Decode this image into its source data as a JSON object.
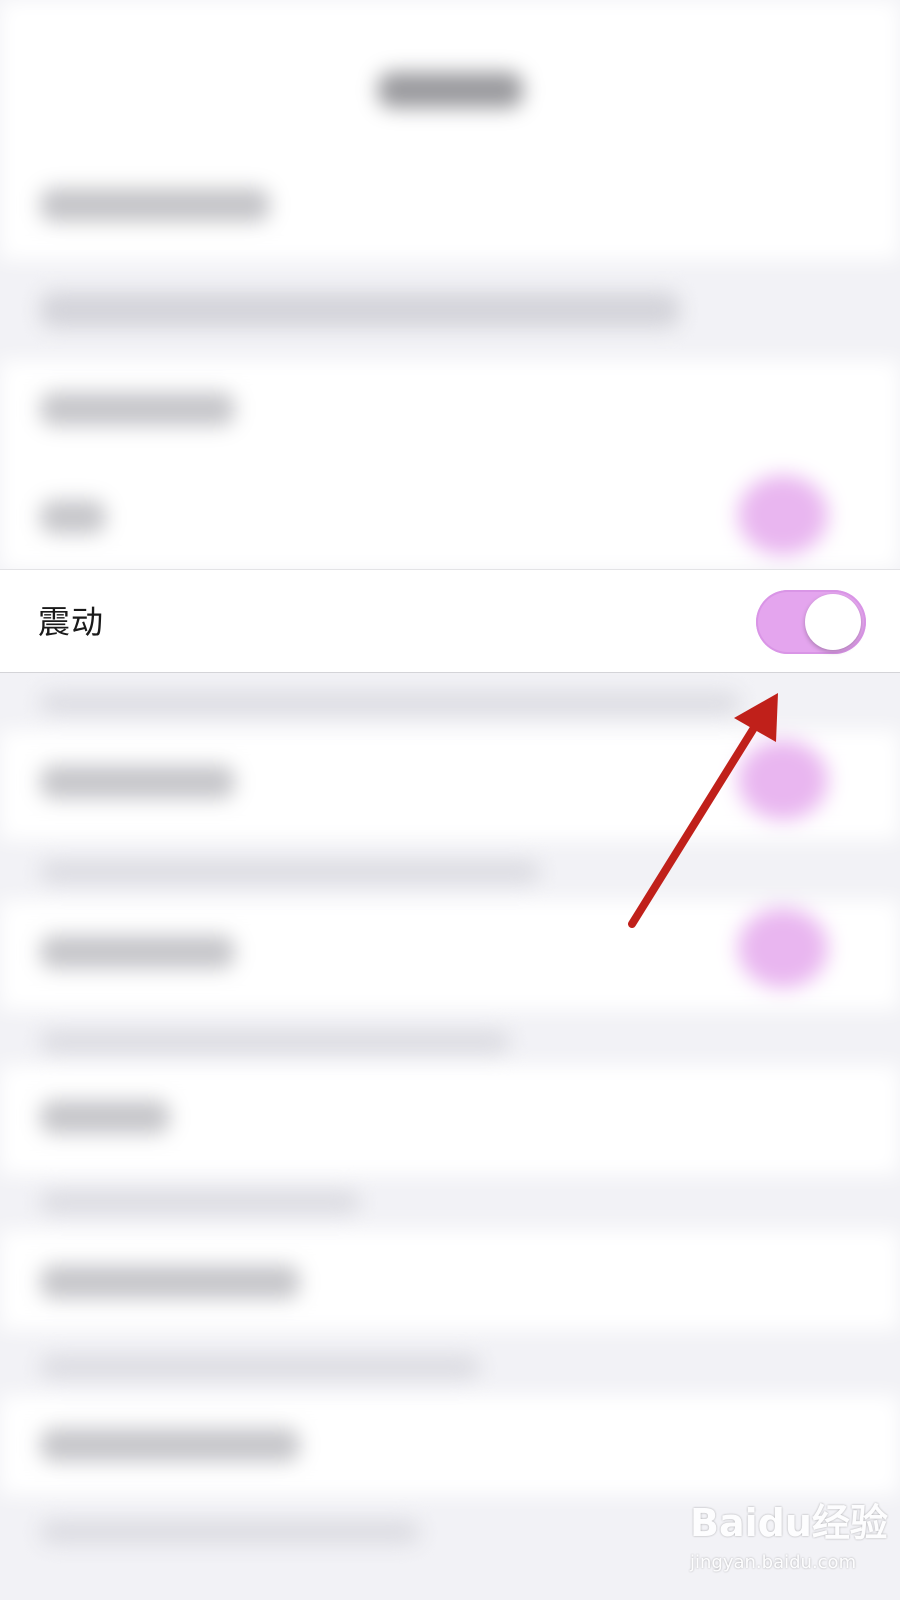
{
  "settings_row": {
    "label": "震动",
    "toggle_state": "on"
  },
  "colors": {
    "toggle_on": "#e4a5ee",
    "annotation_arrow": "#c0201a",
    "page_background": "#f2f2f6"
  },
  "watermark": {
    "brand": "Baidu经验",
    "url": "jingyan.baidu.com"
  }
}
